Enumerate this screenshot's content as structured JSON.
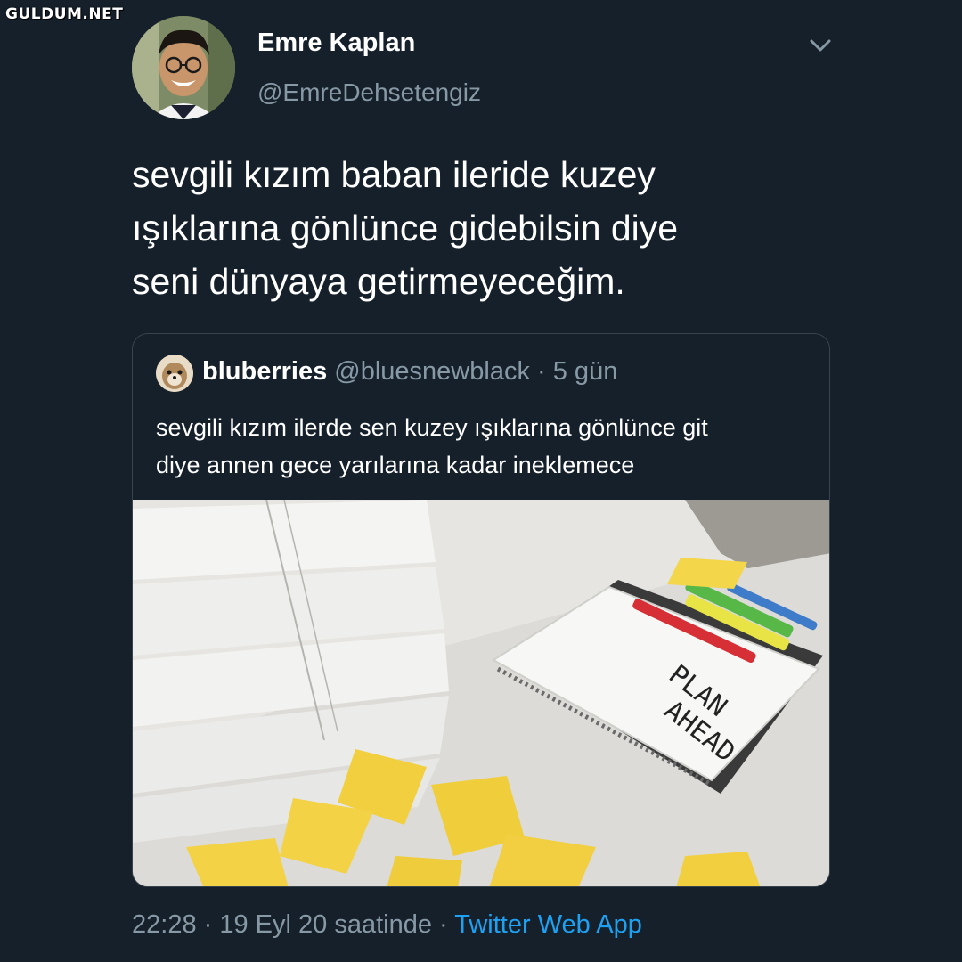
{
  "watermark": "GULDUM.NET",
  "tweet": {
    "author_name": "Emre Kaplan",
    "author_handle": "@EmreDehsetengiz",
    "text": "sevgili kızım baban ileride kuzey\nışıklarına gönlünce gidebilsin diye\nseni dünyaya getirmeyeceğim.",
    "menu_icon": "chevron-down-icon"
  },
  "quoted_tweet": {
    "author_name": "bluberries",
    "author_handle": "@bluesnewblack",
    "separator": "·",
    "time_ago": "5 gün",
    "text": "sevgili kızım ilerde  sen kuzey ışıklarına gönlünce git\ndiye annen gece yarılarına kadar ineklemece",
    "image": {
      "notebook_text_line1": "PLAN",
      "notebook_text_line2": "AHEAD"
    }
  },
  "footer": {
    "timestamp": "22:28 · 19 Eyl 20 saatinde",
    "separator": "·",
    "source": "Twitter Web App"
  },
  "colors": {
    "background": "#15202b",
    "text_primary": "#ffffff",
    "text_secondary": "#8899a6",
    "border": "#38444d",
    "accent": "#1da1f2"
  }
}
